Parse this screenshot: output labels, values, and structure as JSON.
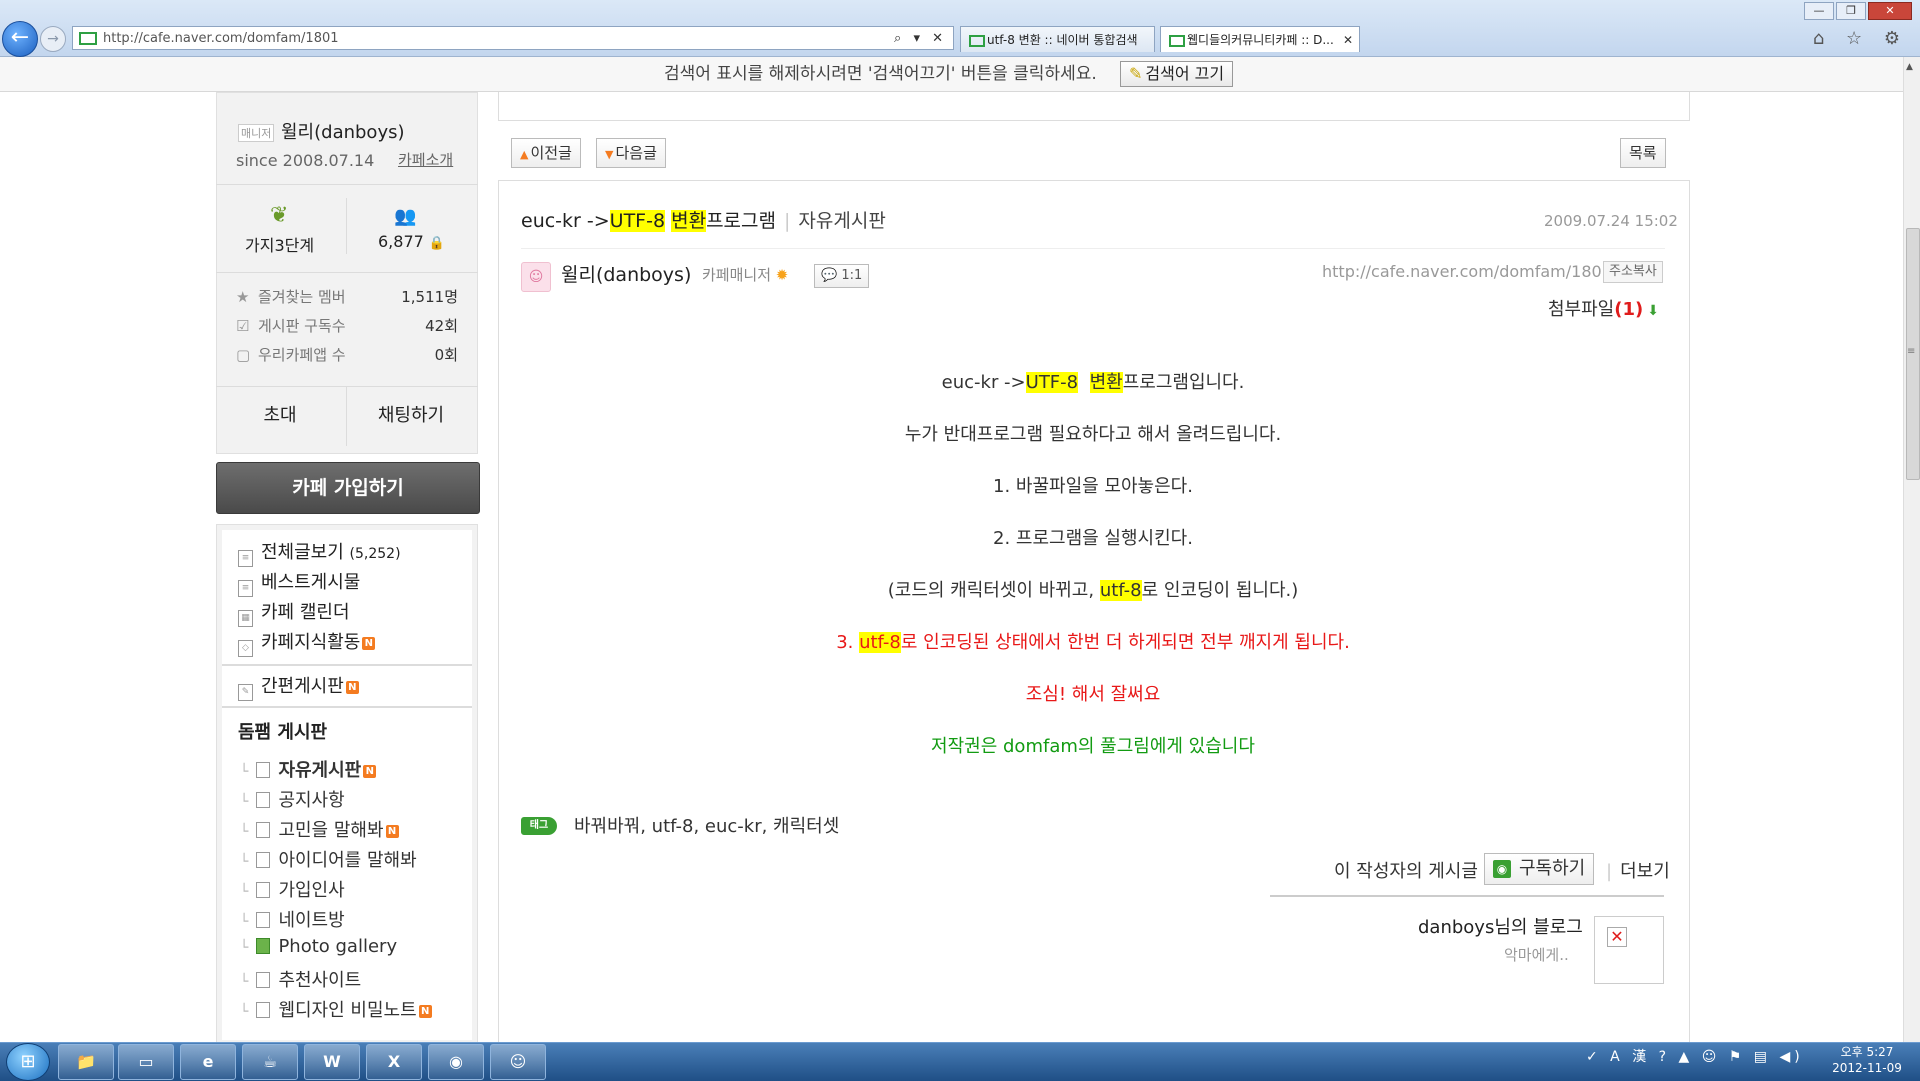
{
  "browser": {
    "address_url": "http://cafe.naver.com/domfam/1801",
    "address_controls": "⌕ ▾ ✕",
    "tabs": [
      {
        "title": "utf-8 변환 :: 네이버 통합검색"
      },
      {
        "title": "웹디들의커뮤니티카페 :: D..."
      }
    ],
    "window_controls": {
      "minimize": "—",
      "restore": "❐",
      "close": "✕"
    },
    "toolbar_icons": [
      "home-icon",
      "star-icon",
      "gear-icon"
    ],
    "toolbar_glyphs": "⌂ ☆ ⚙"
  },
  "search_notice": {
    "text": "검색어 표시를 해제하시려면 '검색어끄기' 버튼을 클릭하세요.",
    "button_label": "검색어 끄기"
  },
  "sidebar": {
    "manager_badge": "매니저",
    "manager_name": "윌리(danboys)",
    "since": "since 2008.07.14",
    "cafe_intro": "카페소개",
    "level": "가지3단계",
    "member_count": "6,877",
    "stats": [
      {
        "label": "즐겨찾는 멤버",
        "value": "1,511명",
        "icon": "star-icon"
      },
      {
        "label": "게시판 구독수",
        "value": "42회",
        "icon": "checkbox-icon"
      },
      {
        "label": "우리카페앱 수",
        "value": "0회",
        "icon": "app-icon"
      }
    ],
    "invite_label": "초대",
    "chat_label": "채팅하기",
    "join_label": "카페 가입하기",
    "menu": [
      {
        "label": "전체글보기",
        "count": "(5,252)"
      },
      {
        "label": "베스트게시물"
      },
      {
        "label": "카페 캘린더"
      },
      {
        "label": "카페지식활동",
        "new": "N"
      },
      {
        "label": "간편게시판",
        "new": "N"
      }
    ],
    "board_group": "돔팸 게시판",
    "boards": [
      {
        "label": "자유게시판",
        "new": "N"
      },
      {
        "label": "공지사항"
      },
      {
        "label": "고민을 말해봐",
        "new": "N"
      },
      {
        "label": "아이디어를 말해봐"
      },
      {
        "label": "가입인사"
      },
      {
        "label": "네이트방"
      },
      {
        "label": "Photo gallery"
      },
      {
        "label": "추천사이트"
      },
      {
        "label": "웹디자인 비밀노트",
        "new": "N"
      }
    ]
  },
  "nav": {
    "prev": "이전글",
    "next": "다음글",
    "list": "목록"
  },
  "post": {
    "title_pre": "euc-kr ->",
    "title_hl1": "UTF-8",
    "title_space": " ",
    "title_hl2": "변환",
    "title_post": "프로그램",
    "board": "자유게시판",
    "date": "2009.07.24 15:02",
    "author": "윌리(danboys)",
    "author_role": "카페매니저",
    "chat_badge": "1:1",
    "url": "http://cafe.naver.com/domfam/1801",
    "copy_url": "주소복사",
    "attach_label": "첨부파일",
    "attach_count": "(1)",
    "body": {
      "l1_pre": "euc-kr ->",
      "l1_hl1": "UTF-8",
      "l1_hl2": "변환",
      "l1_post": "프로그램입니다.",
      "l2": "누가 반대프로그램 필요하다고 해서 올려드립니다.",
      "l3": "1. 바꿀파일을 모아놓은다.",
      "l4": "2. 프로그램을 실행시킨다.",
      "l5_pre": "(코드의 캐릭터셋이 바뀌고, ",
      "l5_hl": "utf-8",
      "l5_post": "로 인코딩이 됩니다.)",
      "l6_pre": "3. ",
      "l6_hl": "utf-8",
      "l6_post": "로 인코딩된 상태에서 한번 더 하게되면 전부 깨지게 됩니다.",
      "l7": "조심! 해서 잘써요",
      "l8": "저작권은 domfam의 풀그림에게 있습니다"
    },
    "tag_badge": "태그",
    "tags": "바꿔바꿔, utf-8, euc-kr, 캐릭터셋",
    "author_posts_label": "이 작성자의 게시글",
    "subscribe_label": "구독하기",
    "more_label": "더보기",
    "blog_title": "danboys님의 블로그",
    "blog_desc": "악마에게.."
  },
  "taskbar": {
    "items": [
      "explorer-icon",
      "notepad-icon",
      "ie-icon",
      "java-ee-icon",
      "word-icon",
      "excel-icon",
      "app-icon",
      "messenger-icon"
    ],
    "item_glyphs": [
      "📁",
      "▭",
      "e",
      "☕",
      "W",
      "X",
      "◉",
      "☺"
    ],
    "tray": "✓ A 漢 ? ▲ ☺ ⚑ ▤ ◀)",
    "time": "오후 5:27",
    "date": "2012-11-09"
  }
}
